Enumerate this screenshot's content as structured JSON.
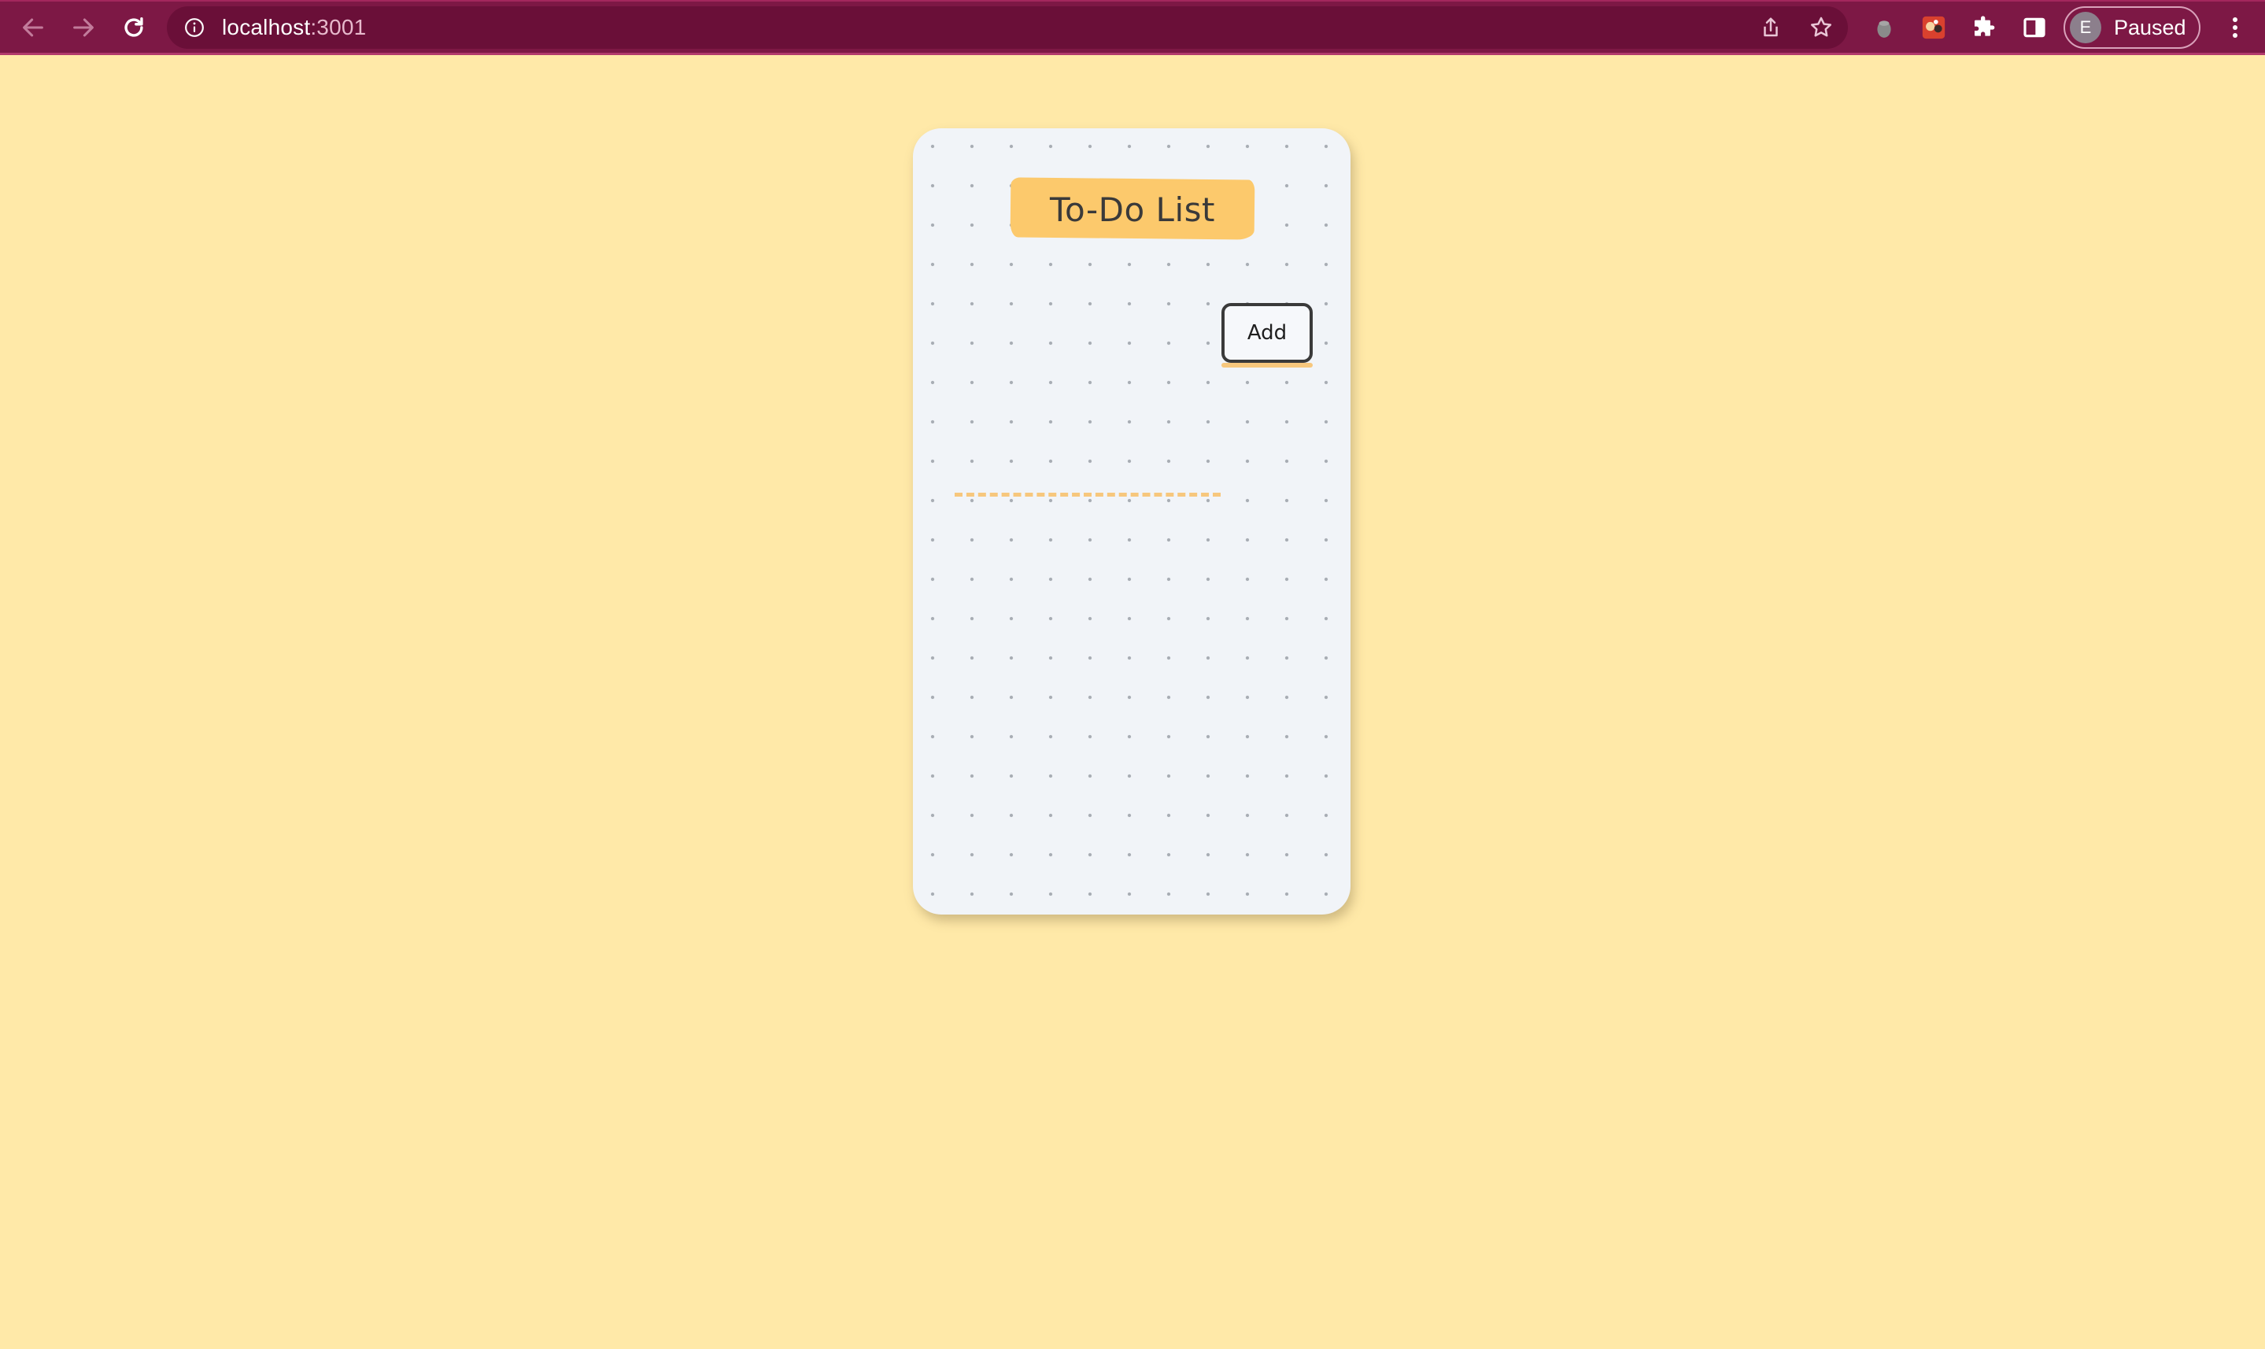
{
  "browser": {
    "url_host": "localhost",
    "url_port": ":3001",
    "profile_initial": "E",
    "profile_status": "Paused",
    "icons": {
      "back": "arrow-left-icon",
      "forward": "arrow-right-icon",
      "reload": "reload-icon",
      "site_info": "info-icon",
      "share": "share-icon",
      "bookmark": "star-icon",
      "extension_1": "extension-icon",
      "extension_2": "extension-icon",
      "extensions": "puzzle-icon",
      "side_panel": "side-panel-icon",
      "menu": "kebab-menu-icon"
    },
    "colors": {
      "toolbar": "#7d1845",
      "omnibox": "#6a0f38"
    }
  },
  "page": {
    "background_color": "#ffe9a8",
    "card_color": "#f1f4f8",
    "accent_color": "#fcc96c"
  },
  "todo": {
    "title": "To-Do List",
    "input": {
      "value": "",
      "placeholder": ""
    },
    "add_label": "Add",
    "items": []
  }
}
